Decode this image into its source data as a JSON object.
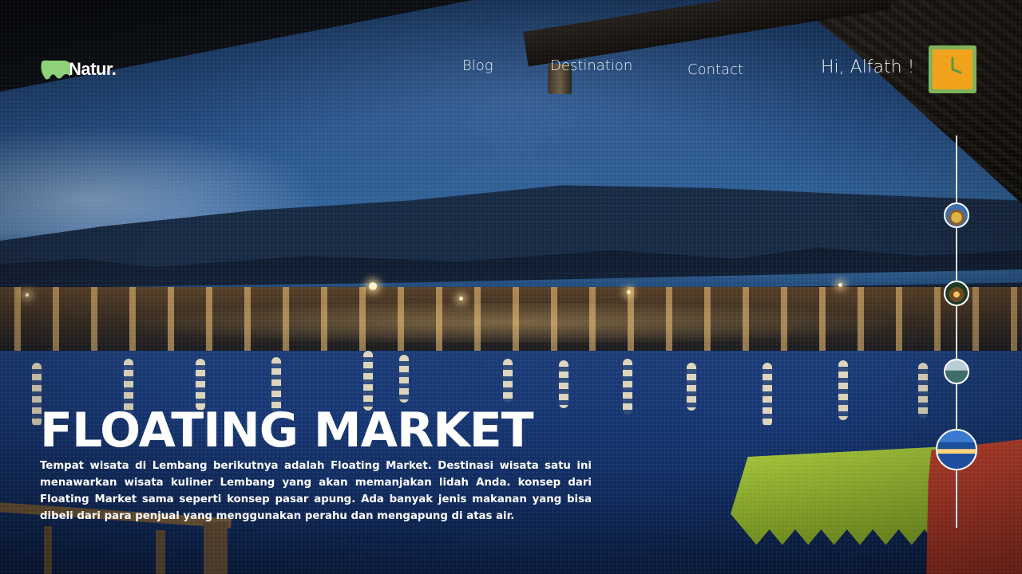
{
  "brand": {
    "name": "Natur.",
    "logo_icon": "leaf-blob-icon",
    "logo_color": "#8fd07a"
  },
  "nav": [
    {
      "label": "Blog"
    },
    {
      "label": "Destination"
    },
    {
      "label": "Contact"
    }
  ],
  "user": {
    "greeting": "Hi, Alfath !",
    "clock_icon": "clock-icon"
  },
  "colors": {
    "accent_green": "#7fb35a",
    "accent_orange": "#f0a21d"
  },
  "timeline": {
    "items": [
      {
        "name": "destination-thumb-1",
        "active": false
      },
      {
        "name": "destination-thumb-2",
        "active": false
      },
      {
        "name": "destination-thumb-3",
        "active": false
      },
      {
        "name": "destination-thumb-4",
        "active": true
      }
    ]
  },
  "hero": {
    "title": "FLOATING MARKET",
    "description": "Tempat wisata di Lembang berikutnya adalah Floating Market. Destinasi wisata satu ini menawarkan wisata kuliner Lembang yang akan memanjakan lidah Anda. konsep dari Floating Market sama seperti konsep pasar apung. Ada banyak jenis makanan yang bisa dibeli dari para penjual yang menggunakan perahu dan mengapung di atas air."
  }
}
